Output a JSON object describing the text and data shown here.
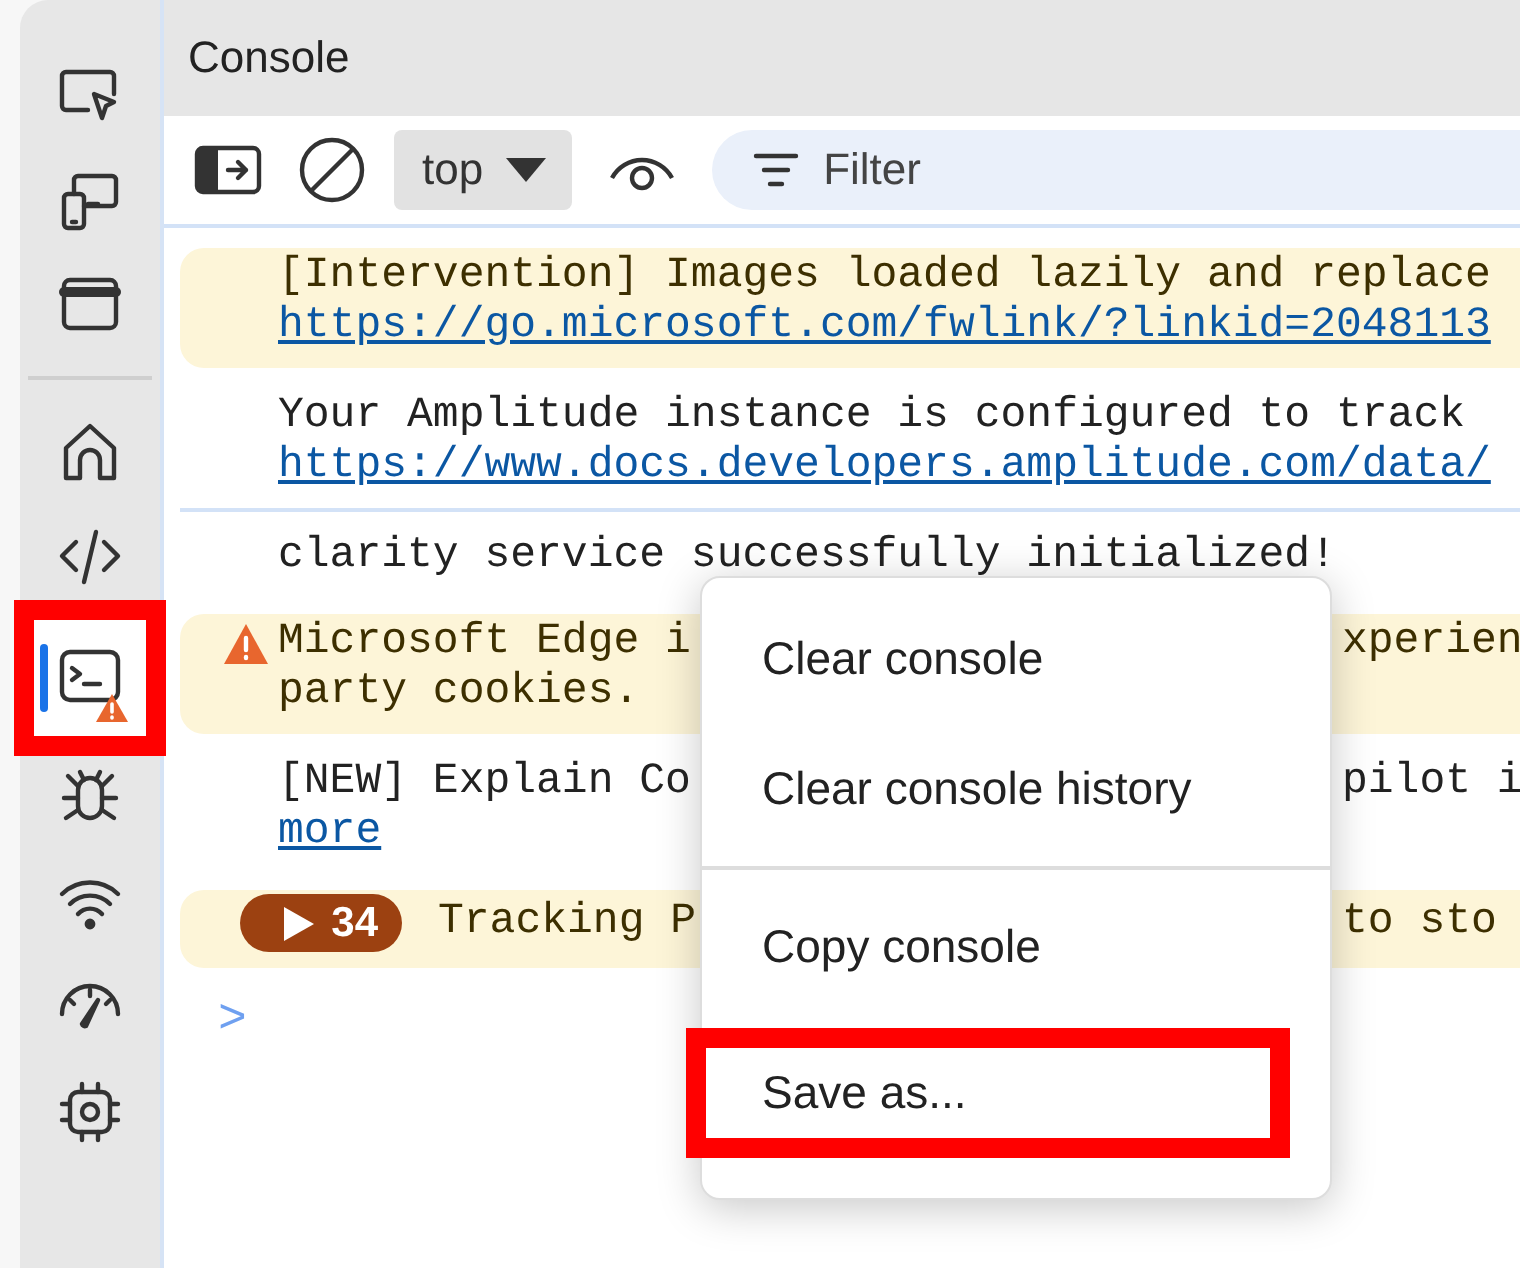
{
  "sidebar": {
    "items": [
      {
        "kind": "inspect",
        "selected": false,
        "highlighted": false,
        "warning": false
      },
      {
        "kind": "device",
        "selected": false,
        "highlighted": false,
        "warning": false
      },
      {
        "kind": "window",
        "selected": false,
        "highlighted": false,
        "warning": false
      },
      {
        "kind": "divider"
      },
      {
        "kind": "home",
        "selected": false,
        "highlighted": false,
        "warning": false
      },
      {
        "kind": "code",
        "selected": false,
        "highlighted": false,
        "warning": false
      },
      {
        "kind": "console",
        "selected": true,
        "highlighted": true,
        "warning": true
      },
      {
        "kind": "bug",
        "selected": false,
        "highlighted": false,
        "warning": false
      },
      {
        "kind": "wifi",
        "selected": false,
        "highlighted": false,
        "warning": false
      },
      {
        "kind": "gauge",
        "selected": false,
        "highlighted": false,
        "warning": false
      },
      {
        "kind": "chip",
        "selected": false,
        "highlighted": false,
        "warning": false
      }
    ]
  },
  "panel": {
    "title": "Console"
  },
  "toolbar": {
    "context": "top",
    "filter": {
      "placeholder": "Filter"
    }
  },
  "messages": [
    {
      "kind": "warning",
      "icon": false,
      "lines": [
        {
          "kind": "text",
          "left": "[Intervention] Images loaded lazily and replace"
        },
        {
          "kind": "link",
          "left": "https://go.microsoft.com/fwlink/?linkid=2048113"
        }
      ]
    },
    {
      "kind": "info",
      "icon": false,
      "lines": [
        {
          "kind": "text",
          "left": "Your Amplitude instance is configured to track"
        },
        {
          "kind": "link",
          "left": "https://www.docs.developers.amplitude.com/data/"
        }
      ]
    },
    {
      "kind": "info",
      "icon": false,
      "lines": [
        {
          "kind": "text",
          "left": "clarity service successfully initialized!"
        }
      ]
    },
    {
      "kind": "warning",
      "icon": true,
      "lines": [
        {
          "kind": "text",
          "left": "Microsoft Edge i",
          "right": "xperien"
        },
        {
          "kind": "text",
          "left": "party cookies."
        }
      ]
    },
    {
      "kind": "info",
      "icon": false,
      "lines": [
        {
          "kind": "text",
          "left": "[NEW] Explain Co",
          "right": "pilot i"
        },
        {
          "kind": "link",
          "left": "more"
        }
      ]
    },
    {
      "kind": "group",
      "icon": false,
      "count": "34",
      "lines": [
        {
          "kind": "text",
          "left": "Tracking P",
          "right": "to sto"
        }
      ]
    }
  ],
  "prompt": ">",
  "menu": {
    "items": [
      {
        "kind": "item",
        "label": "Clear console",
        "highlighted": false
      },
      {
        "kind": "item",
        "label": "Clear console history",
        "highlighted": false
      },
      {
        "kind": "separator"
      },
      {
        "kind": "item",
        "label": "Copy console",
        "highlighted": false
      },
      {
        "kind": "item",
        "label": "Save as...",
        "highlighted": true
      }
    ]
  }
}
